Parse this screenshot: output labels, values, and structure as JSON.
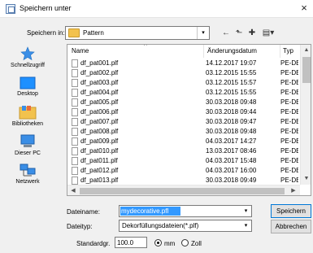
{
  "window": {
    "title": "Speichern unter",
    "close": "×"
  },
  "lookin": {
    "label": "Speichern in:",
    "value": "Pattern",
    "arrow": "▾"
  },
  "toolbar": {
    "back": "←",
    "up_folder": "⬑",
    "new_folder": "✚",
    "view_menu": "▤▾"
  },
  "places": [
    {
      "label": "Schnellzugriff",
      "icon": "star-icon"
    },
    {
      "label": "Desktop",
      "icon": "desktop-icon"
    },
    {
      "label": "Bibliotheken",
      "icon": "libraries-icon"
    },
    {
      "label": "Dieser PC",
      "icon": "pc-icon"
    },
    {
      "label": "Netzwerk",
      "icon": "network-icon"
    }
  ],
  "columns": {
    "name": "Name",
    "date": "Änderungsdatum",
    "type": "Typ"
  },
  "files": [
    {
      "name": "df_pat001.plf",
      "date": "14.12.2017 19:07",
      "type": "PE-DES"
    },
    {
      "name": "df_pat002.plf",
      "date": "03.12.2015 15:55",
      "type": "PE-DES"
    },
    {
      "name": "df_pat003.plf",
      "date": "03.12.2015 15:57",
      "type": "PE-DES"
    },
    {
      "name": "df_pat004.plf",
      "date": "03.12.2015 15:55",
      "type": "PE-DES"
    },
    {
      "name": "df_pat005.plf",
      "date": "30.03.2018 09:48",
      "type": "PE-DES"
    },
    {
      "name": "df_pat006.plf",
      "date": "30.03.2018 09:44",
      "type": "PE-DES"
    },
    {
      "name": "df_pat007.plf",
      "date": "30.03.2018 09:47",
      "type": "PE-DES"
    },
    {
      "name": "df_pat008.plf",
      "date": "30.03.2018 09:48",
      "type": "PE-DES"
    },
    {
      "name": "df_pat009.plf",
      "date": "04.03.2017 14:27",
      "type": "PE-DES"
    },
    {
      "name": "df_pat010.plf",
      "date": "13.03.2017 08:46",
      "type": "PE-DES"
    },
    {
      "name": "df_pat011.plf",
      "date": "04.03.2017 15:48",
      "type": "PE-DES"
    },
    {
      "name": "df_pat012.plf",
      "date": "04.03.2017 16:00",
      "type": "PE-DES"
    },
    {
      "name": "df_pat013.plf",
      "date": "30.03.2018 09:49",
      "type": "PE-DES"
    }
  ],
  "filename": {
    "label": "Dateiname:",
    "value": "mydecorative.pfl"
  },
  "filetype": {
    "label": "Dateityp:",
    "value": "Dekorfüllungsdateien(*.plf)"
  },
  "buttons": {
    "save": "Speichern",
    "cancel": "Abbrechen"
  },
  "standard": {
    "label": "Standardgr.",
    "value": "100.0"
  },
  "units": {
    "mm": "mm",
    "zoll": "Zoll",
    "selected": "mm"
  }
}
